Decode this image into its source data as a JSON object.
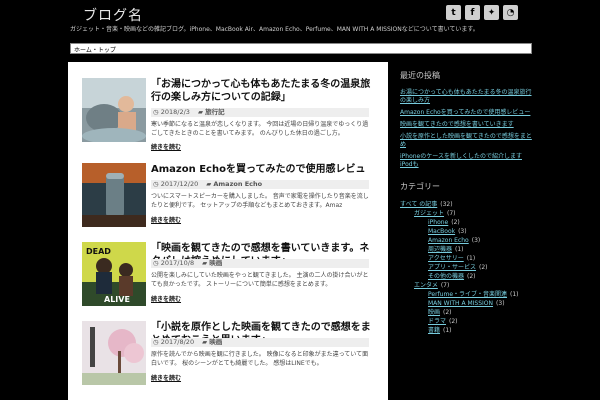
{
  "header": {
    "title": "ブログ名",
    "description": "ガジェット・音楽・映画などの雑記ブログ。iPhone、MacBook Air、Amazon Echo、Perfume、MAN WITH A MISSIONなどについて書いています。",
    "social": [
      {
        "icon": "twitter-icon",
        "glyph": "t"
      },
      {
        "icon": "facebook-icon",
        "glyph": "f"
      },
      {
        "icon": "feedly-icon",
        "glyph": "✦"
      },
      {
        "icon": "rss-icon",
        "glyph": "◔"
      }
    ]
  },
  "nav": {
    "home_label": "ホーム・トップ"
  },
  "posts": [
    {
      "title": "「お湯につかって心も体もあたたまる冬の温泉旅行の楽しみ方についての記録」",
      "date": "2018/2/3",
      "category": "旅行記",
      "excerpt": "寒い季節になると温泉が恋しくなります。 今回は近場の日帰り温泉でゆっくり過ごしてきたときのことを書いてみます。 のんびりした休日の過ごし方。",
      "more": "続きを読む"
    },
    {
      "title": "Amazon Echoを買ってみたので使用感レビュー",
      "date": "2017/12/20",
      "category": "Amazon Echo",
      "excerpt": "ついにスマートスピーカーを購入しました。 音声で家電を操作したり音楽を流したりと便利です。 セットアップの手順などもまとめておきます。Amaz",
      "more": "続きを読む"
    },
    {
      "title": "「映画を観てきたので感想を書いていきます。ネタバレは控えめにしています」",
      "date": "2017/10/8",
      "category": "映画",
      "excerpt": "公開を楽しみにしていた映画をやっと観てきました。 主演の二人の掛け合いがとても良かったです。 ストーリーについて簡単に感想をまとめます。",
      "more": "続きを読む"
    },
    {
      "title": "「小説を原作とした映画を観てきたので感想をまとめておこうと思います」",
      "date": "2017/8/20",
      "category": "映画",
      "excerpt": "原作を読んでから映画を観に行きました。 映像になると印象がまた違っていて面白いです。 桜のシーンがとても綺麗でした。 感想はLINEでも。",
      "more": "続きを読む"
    }
  ],
  "sidebar": {
    "recent_title": "最近の投稿",
    "recent": [
      "お湯につかって心も体もあたたまる冬の温泉旅行の楽しみ方",
      "Amazon Echoを買ってみたので使用感レビュー",
      "映画を観てきたので感想を書いていきます",
      "小説を原作とした映画を観てきたので感想をまとめ",
      "iPhoneのケースを新しくしたので紹介します iPodも"
    ],
    "cat_title": "カテゴリー",
    "categories": [
      {
        "name": "すべて の記事",
        "count": "(32)",
        "indent": 0
      },
      {
        "name": "ガジェット",
        "count": "(7)",
        "indent": 1
      },
      {
        "name": "iPhone",
        "count": "(2)",
        "indent": 2
      },
      {
        "name": "MacBook",
        "count": "(3)",
        "indent": 2
      },
      {
        "name": "Amazon Echo",
        "count": "(3)",
        "indent": 2
      },
      {
        "name": "周辺機器",
        "count": "(1)",
        "indent": 2
      },
      {
        "name": "アクセサリー",
        "count": "(1)",
        "indent": 2
      },
      {
        "name": "アプリ・サービス",
        "count": "(2)",
        "indent": 2
      },
      {
        "name": "その他の機器",
        "count": "(2)",
        "indent": 2
      },
      {
        "name": "エンタメ",
        "count": "(7)",
        "indent": 1
      },
      {
        "name": "Perfume・ライブ・音楽関連",
        "count": "(1)",
        "indent": 2
      },
      {
        "name": "MAN WITH A MISSION",
        "count": "(3)",
        "indent": 2
      },
      {
        "name": "映画",
        "count": "(2)",
        "indent": 2
      },
      {
        "name": "ドラマ",
        "count": "(2)",
        "indent": 2
      },
      {
        "name": "書籍",
        "count": "(1)",
        "indent": 2
      }
    ]
  }
}
